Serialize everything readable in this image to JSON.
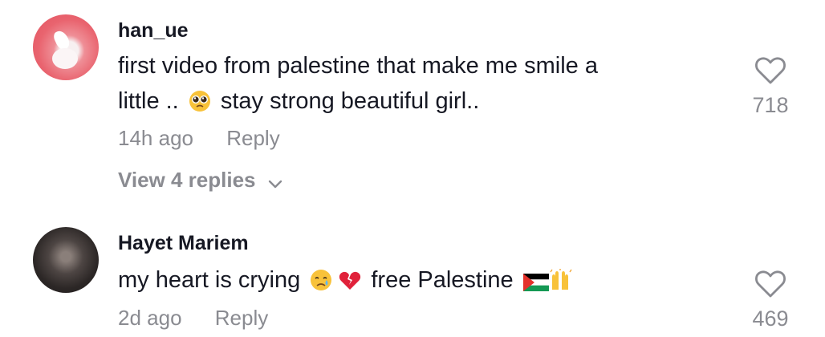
{
  "comments": [
    {
      "username": "han_ue",
      "text_line1": "first video from palestine that make me smile a",
      "text_line2_pre": "little ..",
      "text_line2_emoji": "pleading-face-icon",
      "text_line2_post": "stay strong beautiful girl..",
      "time": "14h ago",
      "reply_label": "Reply",
      "view_replies_label": "View 4 replies",
      "likes": "718"
    },
    {
      "username": "Hayet Mariem",
      "text_pre": "my heart is crying",
      "emojis_1": [
        "crying-face-icon",
        "broken-heart-icon"
      ],
      "text_mid": "free Palestine",
      "emojis_2": [
        "palestine-flag-icon",
        "raising-hands-icon"
      ],
      "time": "2d ago",
      "reply_label": "Reply",
      "likes": "469"
    }
  ],
  "colors": {
    "text": "#161823",
    "muted": "#8a8b91"
  }
}
